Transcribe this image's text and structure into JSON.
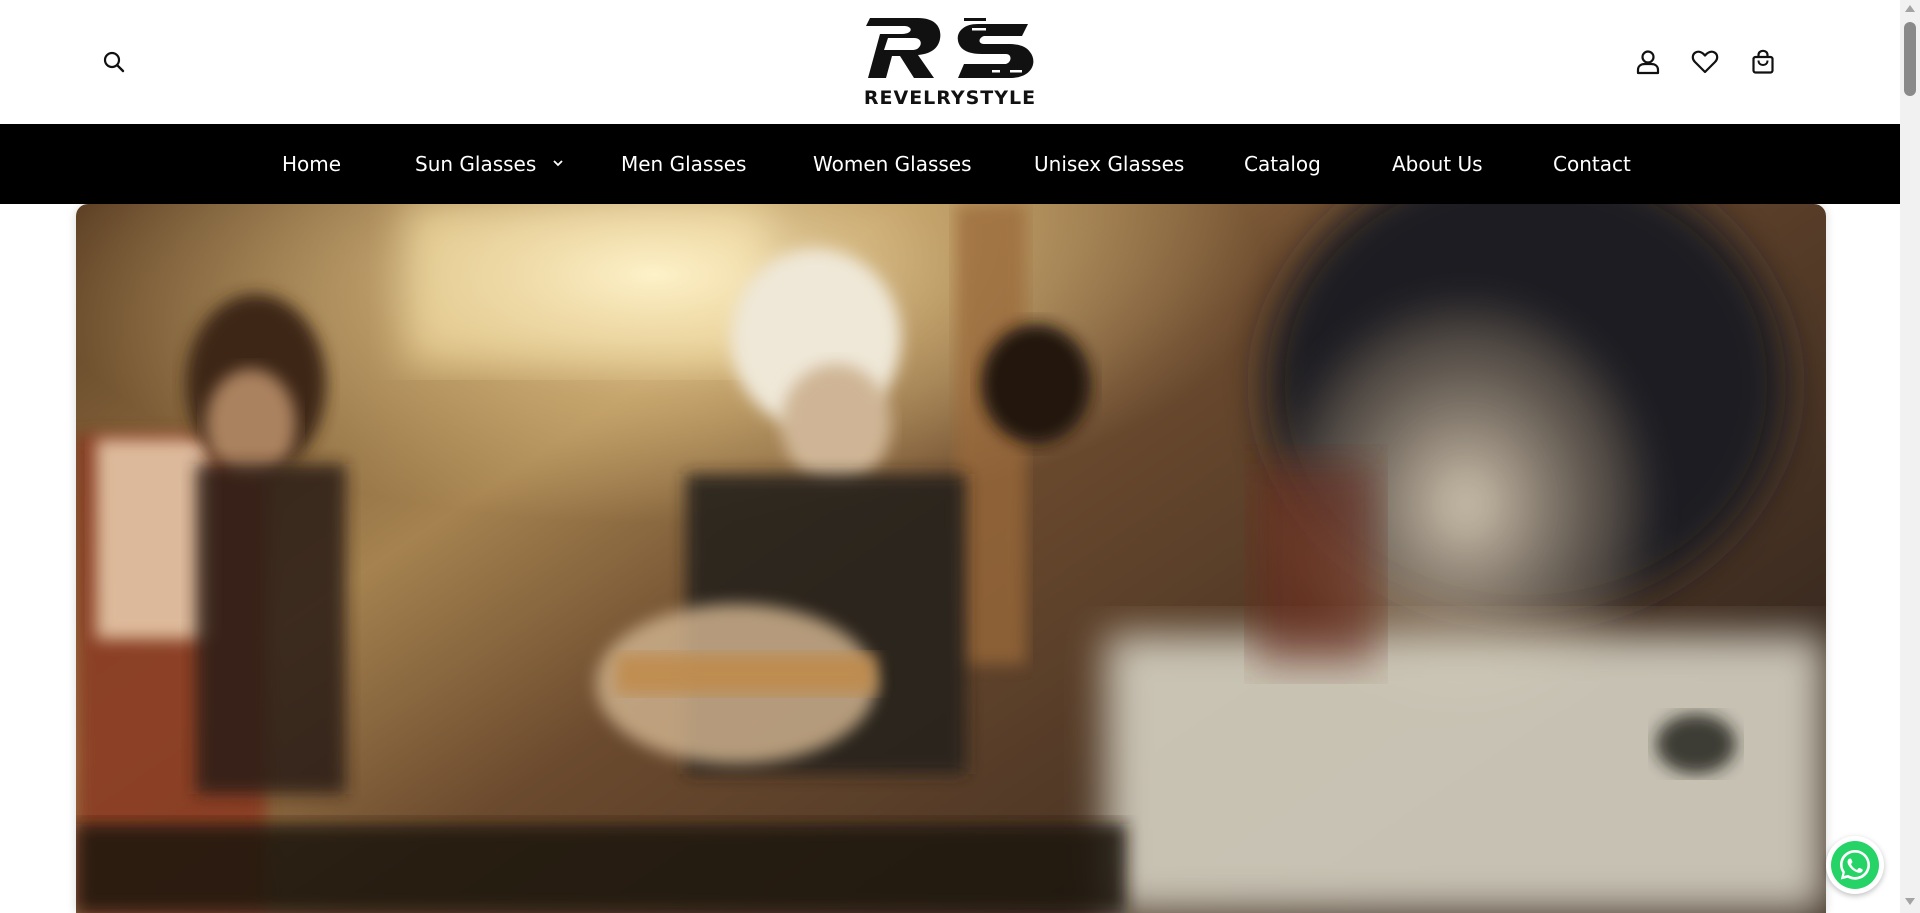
{
  "header": {
    "logo_text": "REVELRYSTYLE",
    "logo_monogram": "RS",
    "search_icon": "search-icon",
    "account_icon": "user-icon",
    "wishlist_icon": "heart-icon",
    "cart_icon": "shopping-bag-icon"
  },
  "nav": {
    "items": [
      {
        "label": "Home"
      },
      {
        "label": "Sun Glasses",
        "has_dropdown": true,
        "dropdown_icon": "chevron-down-icon"
      },
      {
        "label": "Men Glasses"
      },
      {
        "label": "Women Glasses"
      },
      {
        "label": "Unisex Glasses"
      },
      {
        "label": "Catalog"
      },
      {
        "label": "About Us"
      },
      {
        "label": "Contact"
      }
    ]
  },
  "hero": {
    "type": "video",
    "scene": "band-on-bus"
  },
  "floating": {
    "whatsapp_icon": "whatsapp-icon"
  },
  "colors": {
    "nav_background": "#000000",
    "nav_text": "#ffffff",
    "header_background": "#ffffff",
    "whatsapp_green": "#25D366"
  }
}
